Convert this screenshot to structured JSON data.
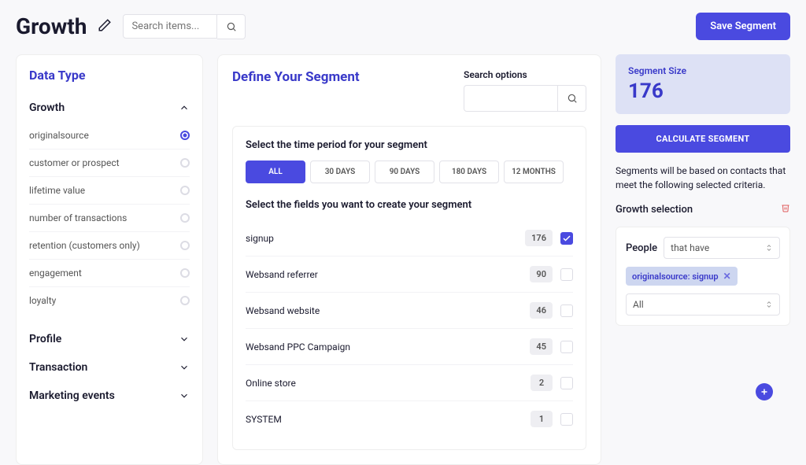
{
  "header": {
    "title": "Growth",
    "search_placeholder": "Search items...",
    "save_label": "Save Segment"
  },
  "sidebar": {
    "title": "Data Type",
    "groups": [
      {
        "label": "Growth",
        "expanded": true,
        "items": [
          {
            "label": "originalsource",
            "selected": true
          },
          {
            "label": "customer or prospect",
            "selected": false
          },
          {
            "label": "lifetime value",
            "selected": false
          },
          {
            "label": "number of transactions",
            "selected": false
          },
          {
            "label": "retention (customers only)",
            "selected": false
          },
          {
            "label": "engagement",
            "selected": false
          },
          {
            "label": "loyalty",
            "selected": false
          }
        ]
      },
      {
        "label": "Profile",
        "expanded": false
      },
      {
        "label": "Transaction",
        "expanded": false
      },
      {
        "label": "Marketing events",
        "expanded": false
      }
    ]
  },
  "main": {
    "title": "Define Your Segment",
    "options_label": "Search options",
    "time_label": "Select the time period for your segment",
    "time_tabs": [
      {
        "label": "ALL",
        "active": true
      },
      {
        "label": "30 DAYS",
        "active": false
      },
      {
        "label": "90 DAYS",
        "active": false
      },
      {
        "label": "180 DAYS",
        "active": false
      },
      {
        "label": "12 MONTHS",
        "active": false
      }
    ],
    "fields_label": "Select the fields you want to create your segment",
    "fields": [
      {
        "label": "signup",
        "count": "176",
        "checked": true
      },
      {
        "label": "Websand referrer",
        "count": "90",
        "checked": false
      },
      {
        "label": "Websand website",
        "count": "46",
        "checked": false
      },
      {
        "label": "Websand PPC Campaign",
        "count": "45",
        "checked": false
      },
      {
        "label": "Online store",
        "count": "2",
        "checked": false
      },
      {
        "label": "SYSTEM",
        "count": "1",
        "checked": false
      }
    ]
  },
  "right": {
    "size_label": "Segment Size",
    "size_value": "176",
    "calc_label": "CALCULATE SEGMENT",
    "desc": "Segments will be based on contacts that meet the following selected criteria.",
    "selection_label": "Growth selection",
    "people_label": "People",
    "people_select": "that have",
    "chip": "originalsource: signup",
    "all_select": "All"
  }
}
